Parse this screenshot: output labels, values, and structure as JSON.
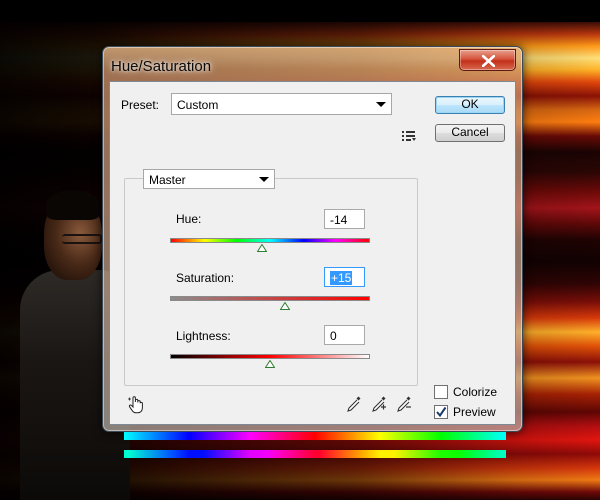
{
  "dialog": {
    "title": "Hue/Saturation",
    "preset_label": "Preset:",
    "preset_value": "Custom",
    "ok_label": "OK",
    "cancel_label": "Cancel",
    "channel_value": "Master",
    "hue": {
      "label": "Hue:",
      "value": "-14",
      "slider_min": -180,
      "slider_max": 180
    },
    "saturation": {
      "label": "Saturation:",
      "value": "+15",
      "slider_min": -100,
      "slider_max": 100
    },
    "lightness": {
      "label": "Lightness:",
      "value": "0",
      "slider_min": -100,
      "slider_max": 100
    },
    "colorize_label": "Colorize",
    "colorize_checked": false,
    "preview_label": "Preview",
    "preview_checked": true
  },
  "icons": {
    "close": "close-icon",
    "preset_options": "preset-options-icon",
    "dropdown": "chevron-down-icon",
    "target_adjust": "hand-target-icon",
    "eyedropper": "eyedropper-icon",
    "eyedropper_add": "eyedropper-plus-icon",
    "eyedropper_subtract": "eyedropper-minus-icon",
    "checkmark": "checkmark-icon"
  },
  "colors": {
    "close_button": "#c2301a",
    "selection": "#3399ff",
    "default_button_border": "#3c7fb1",
    "slider_thumb": "#2e7d32"
  }
}
